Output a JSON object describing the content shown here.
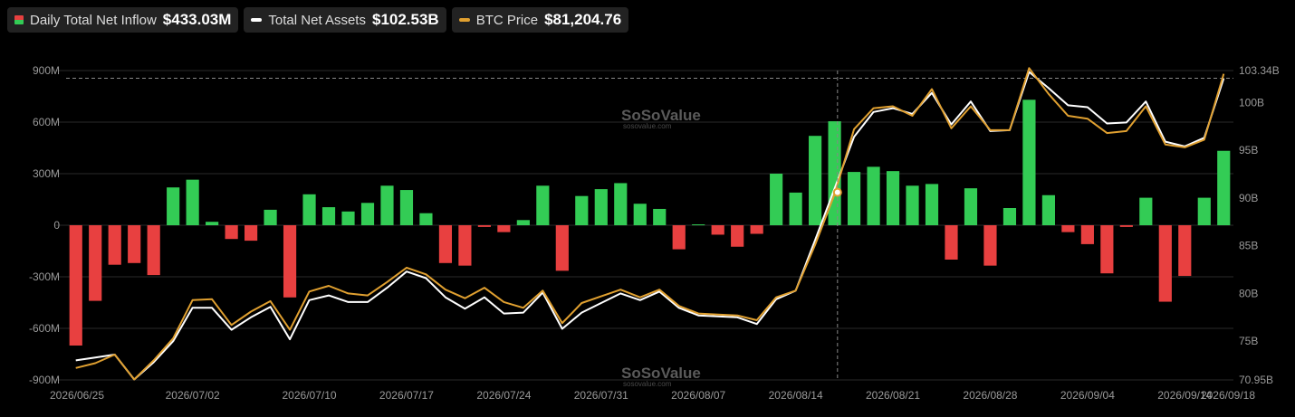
{
  "legend": {
    "inflow": {
      "label": "Daily Total Net Inflow",
      "value": "$433.03M",
      "color_pos": "#33cc55",
      "color_neg": "#e84040"
    },
    "assets": {
      "label": "Total Net Assets",
      "value": "$102.53B",
      "color": "#ffffff"
    },
    "btc": {
      "label": "BTC Price",
      "value": "$81,204.76",
      "color": "#e0a030"
    }
  },
  "watermark": {
    "text": "SoSoValue",
    "sub": "sosovalue.com"
  },
  "chart_data": {
    "type": "bar",
    "x_tick_labels": [
      "2026/06/25",
      "2026/07/02",
      "2026/07/10",
      "2026/07/17",
      "2026/07/24",
      "2026/07/31",
      "2026/08/07",
      "2026/08/14",
      "2026/08/21",
      "2026/08/28",
      "2026/09/04",
      "2026/09/14",
      "2026/09/18"
    ],
    "x_tick_index": [
      0,
      6,
      12,
      17,
      22,
      27,
      32,
      37,
      42,
      47,
      52,
      57,
      60
    ],
    "y_left": {
      "ticks": [
        "900M",
        "600M",
        "300M",
        "0",
        "-300M",
        "-600M",
        "-900M"
      ],
      "range": [
        -900,
        900
      ],
      "unit": "M"
    },
    "y_right": {
      "ticks": [
        "103.34B",
        "100B",
        "95B",
        "90B",
        "85B",
        "80B",
        "75B",
        "70.95B"
      ],
      "range": [
        70.95,
        103.34
      ],
      "unit": "B"
    },
    "grid": true,
    "crosshair_index": 39,
    "series": [
      {
        "name": "Daily Total Net Inflow",
        "type": "bar",
        "values": [
          -700,
          -440,
          -230,
          -220,
          -290,
          220,
          265,
          20,
          -80,
          -90,
          90,
          -420,
          180,
          105,
          80,
          130,
          230,
          205,
          70,
          -220,
          -235,
          -10,
          -40,
          30,
          230,
          -265,
          170,
          210,
          245,
          125,
          95,
          -140,
          5,
          -55,
          -125,
          -50,
          300,
          190,
          520,
          605,
          310,
          340,
          315,
          230,
          240,
          -200,
          215,
          -235,
          100,
          730,
          175,
          -40,
          -110,
          -280,
          -10,
          160,
          -445,
          -295,
          160,
          433.03
        ]
      },
      {
        "name": "Total Net Assets",
        "type": "line",
        "values": [
          73.0,
          73.3,
          73.6,
          71.0,
          72.8,
          75.0,
          78.5,
          78.5,
          76.2,
          77.5,
          78.6,
          75.2,
          79.3,
          79.8,
          79.1,
          79.1,
          80.6,
          82.3,
          81.6,
          79.6,
          78.4,
          79.6,
          77.9,
          78.0,
          80.1,
          76.3,
          78.0,
          79.0,
          80.0,
          79.3,
          80.2,
          78.5,
          77.7,
          77.6,
          77.5,
          76.8,
          79.4,
          80.3,
          85.6,
          91.0,
          96.4,
          99.0,
          99.4,
          98.8,
          101.0,
          97.7,
          100.1,
          97.0,
          97.1,
          103.2,
          101.5,
          99.7,
          99.5,
          97.8,
          97.9,
          100.1,
          95.9,
          95.4,
          96.3,
          102.53
        ]
      },
      {
        "name": "BTC Price",
        "type": "line",
        "values": [
          72.2,
          72.7,
          73.6,
          71.0,
          73.0,
          75.3,
          79.3,
          79.4,
          76.7,
          78.1,
          79.2,
          76.2,
          80.2,
          80.8,
          80.0,
          79.8,
          81.2,
          82.7,
          82.0,
          80.4,
          79.5,
          80.6,
          79.1,
          78.5,
          80.3,
          76.9,
          79.0,
          79.7,
          80.4,
          79.6,
          80.4,
          78.7,
          77.9,
          77.8,
          77.7,
          77.2,
          79.6,
          80.3,
          85.1,
          90.4,
          97.2,
          99.4,
          99.6,
          98.6,
          101.4,
          97.3,
          99.6,
          97.1,
          97.1,
          103.6,
          100.9,
          98.6,
          98.3,
          96.8,
          97.0,
          99.6,
          95.6,
          95.3,
          96.1,
          103.0
        ]
      }
    ],
    "colors": {
      "positive": "#33cc55",
      "negative": "#e84040",
      "assets_line": "#ffffff",
      "btc_line": "#e0a030",
      "grid": "#2a2a2a",
      "refline": "#888888"
    }
  }
}
